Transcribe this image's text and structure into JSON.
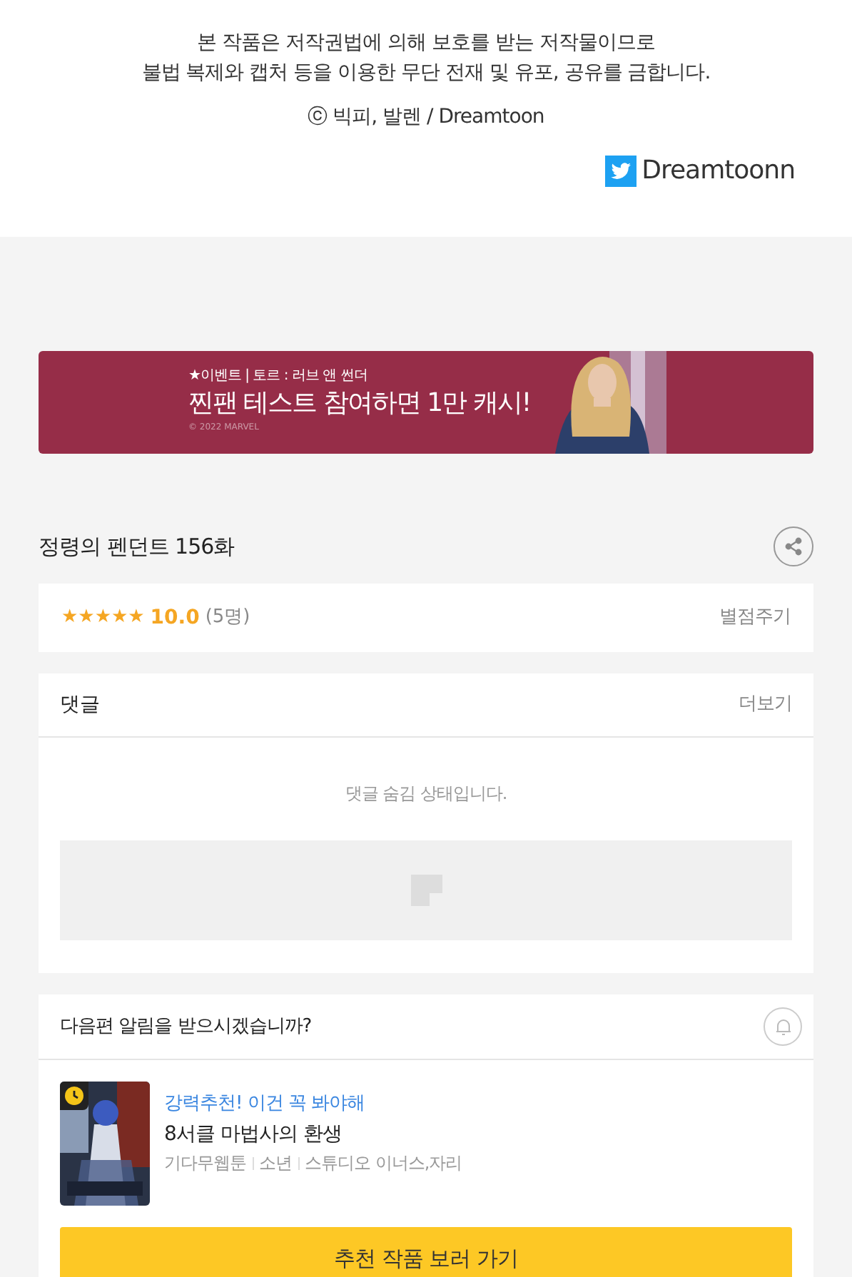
{
  "notice": {
    "lines": [
      "본 작품은 저작권법에 의해 보호를 받는 저작물이므로",
      "불법 복제와 캡처 등을 이용한 무단 전재 및 유포, 공유를 금합니다."
    ],
    "copyright": "ⓒ 빅피, 발렌 / Dreamtoon",
    "twitter": "Dreamtoonn"
  },
  "banner": {
    "kicker": "★이벤트 | 토르 : 러브 앤 썬더",
    "headline": "찐팬 테스트 참여하면 1만 캐시!",
    "credit": "© 2022 MARVEL"
  },
  "episode": {
    "title": "정령의 펜던트 156화"
  },
  "rating": {
    "stars": 5,
    "score": "10.0",
    "count": "(5명)",
    "action": "별점주기"
  },
  "comments": {
    "title": "댓글",
    "more": "더보기",
    "message": "댓글 숨김 상태입니다."
  },
  "notify": {
    "question": "다음편 알림을 받으시겠습니까?",
    "subscribed": false
  },
  "recommend": {
    "tagline": "강력추천! 이건 꼭 봐야해",
    "title": "8서클 마법사의 환생",
    "meta": [
      "기다무웹툰",
      "소년",
      "스튜디오 이너스,자리"
    ],
    "button": "추천 작품 보러 가기"
  }
}
